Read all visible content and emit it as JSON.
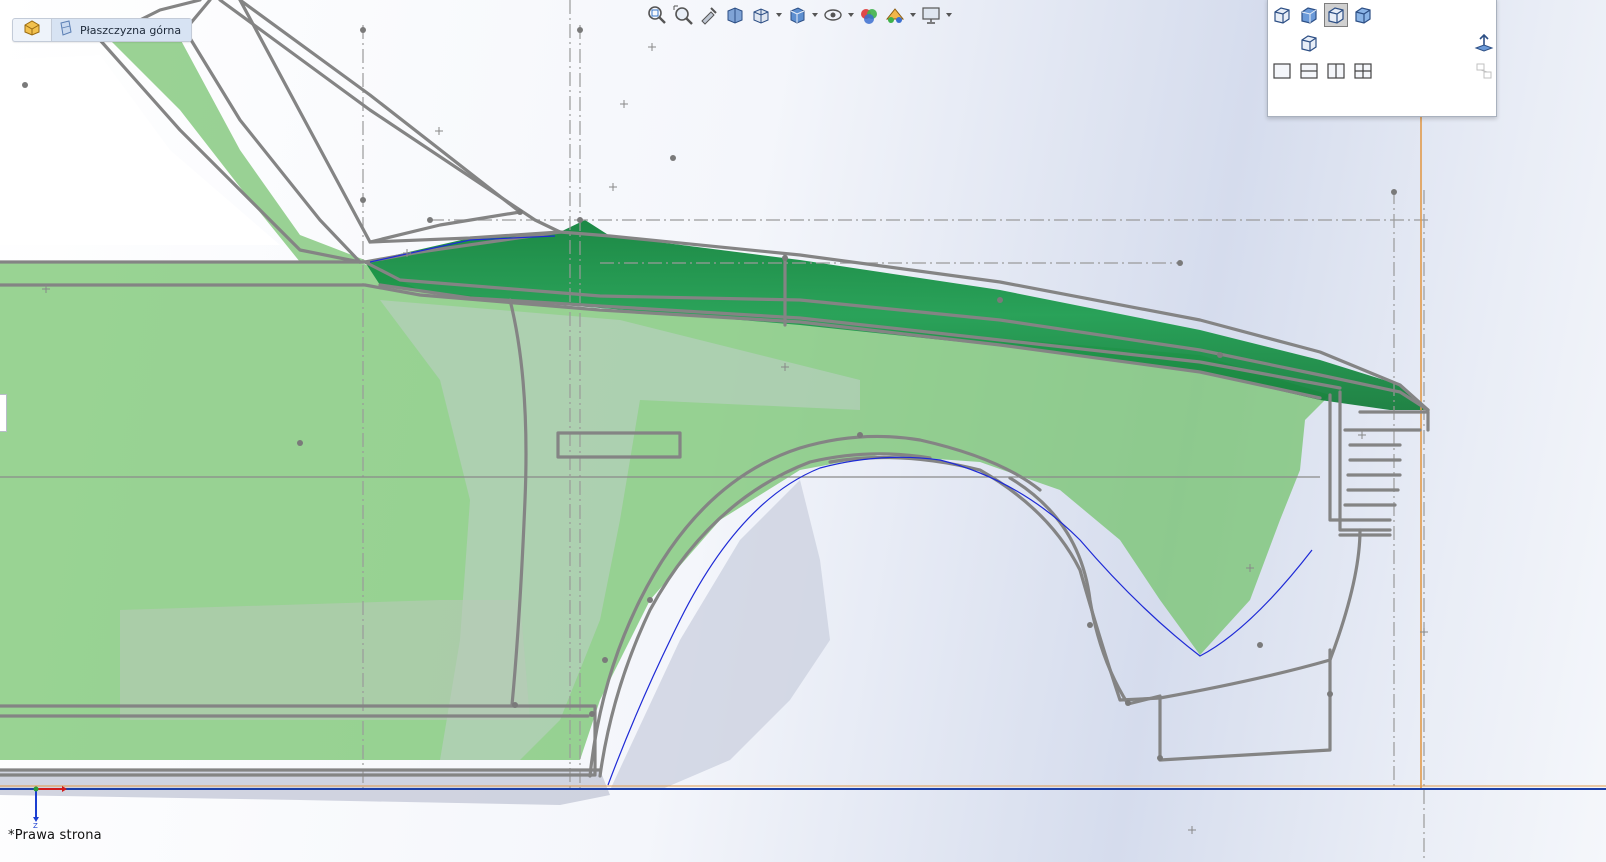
{
  "breadcrumb": {
    "part_icon": "part-icon",
    "plane_icon": "plane-icon",
    "plane_label": "Płaszczyzna górna"
  },
  "heads_up_toolbar": [
    {
      "icon": "zoom-to-fit-icon"
    },
    {
      "icon": "zoom-to-area-icon"
    },
    {
      "icon": "previous-view-icon"
    },
    {
      "icon": "section-view-icon"
    },
    {
      "icon": "dynamic-annotation-views-icon",
      "dropdown": true
    },
    {
      "icon": "view-orientation-icon",
      "dropdown": true
    },
    {
      "icon": "display-style-icon",
      "dropdown": true
    },
    {
      "icon": "hide-show-items-icon",
      "dropdown": true
    },
    {
      "icon": "edit-appearance-icon"
    },
    {
      "icon": "apply-scene-icon",
      "dropdown": true
    },
    {
      "icon": "view-settings-icon",
      "dropdown": true
    }
  ],
  "view_palette": {
    "buttons": [
      {
        "icon": "isometric-view-icon"
      },
      {
        "icon": "trimetric-view-icon"
      },
      {
        "icon": "dimetric-view-icon",
        "active": true
      },
      {
        "icon": "normal-to-view-icon"
      },
      {
        "icon": "view-cube-icon"
      },
      {
        "icon": "view-selector-icon"
      },
      {
        "icon": "single-view-icon"
      },
      {
        "icon": "two-view-horizontal-icon"
      },
      {
        "icon": "two-view-vertical-icon"
      },
      {
        "icon": "four-view-icon"
      },
      {
        "icon": "link-views-icon"
      }
    ]
  },
  "triad": {
    "x_color": "#d11b1b",
    "z_color": "#1b3fd1",
    "z_label": "Z"
  },
  "view_label": "*Prawa strona",
  "colors": {
    "sketch_gray": "#848484",
    "body_green": "#72c26a",
    "fender_green": "#0f8a3c",
    "ground_blue": "#1c3fa8",
    "ref_orange": "#e19a4a",
    "wheel_blue": "#1e2ad6"
  }
}
